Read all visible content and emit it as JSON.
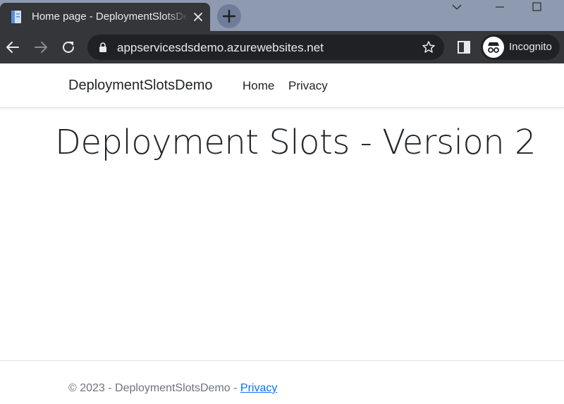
{
  "browser": {
    "tab_title": "Home page - DeploymentSlotsDemo",
    "url": "appservicesdsdemo.azurewebsites.net",
    "profile_label": "Incognito"
  },
  "site": {
    "brand": "DeploymentSlotsDemo",
    "nav": [
      {
        "label": "Home"
      },
      {
        "label": "Privacy"
      }
    ],
    "heading": "Deployment Slots - Version 2",
    "footer": {
      "prefix": "© 2023 - DeploymentSlotsDemo - ",
      "link": "Privacy"
    }
  }
}
